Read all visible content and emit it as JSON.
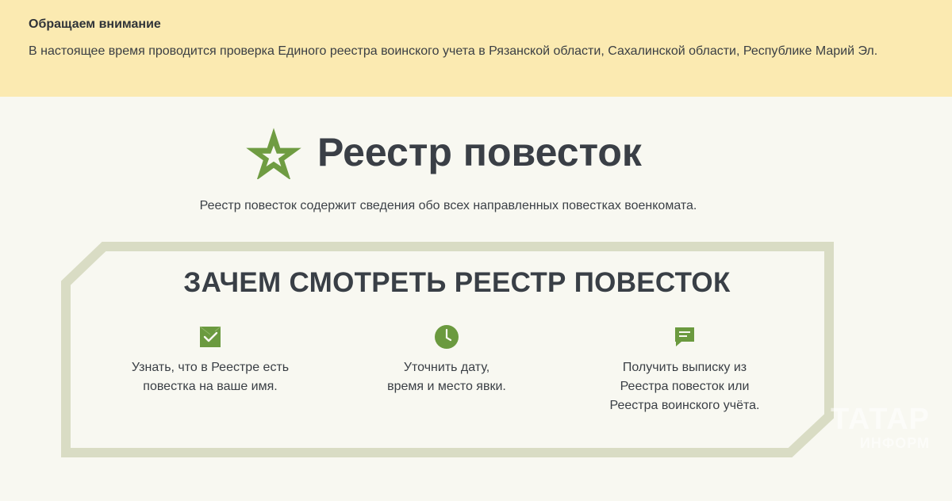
{
  "notice": {
    "title": "Обращаем внимание",
    "text": "В настоящее время проводится проверка Единого реестра воинского учета в Рязанской области, Сахалинской области, Республике Марий Эл."
  },
  "header": {
    "emblem": "star-icon",
    "title": "Реестр повесток",
    "subtitle": "Реестр повесток содержит сведения обо всех направленных повестках военкомата."
  },
  "section": {
    "title": "ЗАЧЕМ СМОТРЕТЬ РЕЕСТР ПОВЕСТОК",
    "features": [
      {
        "icon": "envelope-check-icon",
        "lines": [
          "Узнать, что в Реестре есть",
          "повестка на ваше имя."
        ]
      },
      {
        "icon": "clock-icon",
        "lines": [
          "Уточнить дату,",
          "время и место явки."
        ]
      },
      {
        "icon": "chat-bubble-icon",
        "lines": [
          "Получить выписку из",
          "Реестра повесток или",
          "Реестра воинского учёта."
        ]
      }
    ]
  },
  "watermark": {
    "line1": "ТАТАР",
    "line2": "ИНФОРМ"
  },
  "colors": {
    "notice_bg": "#fbeab1",
    "page_bg": "#f8f8f1",
    "accent_green": "#6b9a3f",
    "frame": "#d9dcc4",
    "text": "#393f45"
  }
}
